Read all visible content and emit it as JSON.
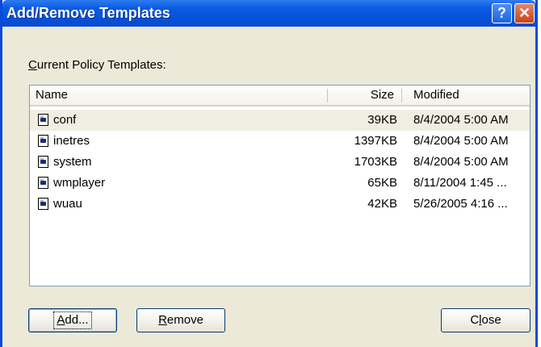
{
  "window": {
    "title": "Add/Remove Templates",
    "help_glyph": "?",
    "close_glyph": "✕"
  },
  "list_label": "Current Policy Templates:",
  "columns": {
    "name": "Name",
    "size": "Size",
    "modified": "Modified"
  },
  "templates": [
    {
      "name": "conf",
      "size": "39KB",
      "modified": "8/4/2004 5:00 AM",
      "selected": true
    },
    {
      "name": "inetres",
      "size": "1397KB",
      "modified": "8/4/2004 5:00 AM"
    },
    {
      "name": "system",
      "size": "1703KB",
      "modified": "8/4/2004 5:00 AM"
    },
    {
      "name": "wmplayer",
      "size": "65KB",
      "modified": "8/11/2004 1:45 ..."
    },
    {
      "name": "wuau",
      "size": "42KB",
      "modified": "5/26/2005 4:16 ..."
    }
  ],
  "buttons": {
    "add": {
      "mnemonic": "A",
      "rest": "dd..."
    },
    "remove": {
      "mnemonic": "R",
      "rest": "emove"
    },
    "close": {
      "pre": "C",
      "mnemonic": "l",
      "rest": "ose"
    }
  },
  "icons": {
    "file": "adm-template-file-icon"
  }
}
